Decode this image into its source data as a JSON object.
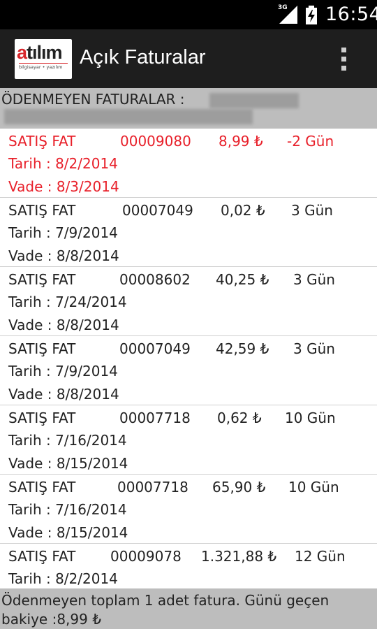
{
  "status_bar": {
    "network": "3G",
    "time": "16:54"
  },
  "app": {
    "logo_text": "atılım",
    "logo_subtext": "bilgisayar • yazılım",
    "title": "Açık Faturalar"
  },
  "header": {
    "label": "ÖDENMEYEN FATURALAR :"
  },
  "invoices": [
    {
      "type": "SATIŞ FAT",
      "number": "00009080",
      "amount": "8,99 ₺",
      "days": "-2 Gün",
      "date": "Tarih : 8/2/2014",
      "due": "Vade : 8/3/2014",
      "overdue": true
    },
    {
      "type": "SATIŞ FAT",
      "number": "00007049",
      "amount": "0,02 ₺",
      "days": "3 Gün",
      "date": "Tarih : 7/9/2014",
      "due": "Vade : 8/8/2014",
      "overdue": false
    },
    {
      "type": "SATIŞ FAT",
      "number": "00008602",
      "amount": "40,25 ₺",
      "days": "3 Gün",
      "date": "Tarih : 7/24/2014",
      "due": "Vade : 8/8/2014",
      "overdue": false
    },
    {
      "type": "SATIŞ FAT",
      "number": "00007049",
      "amount": "42,59 ₺",
      "days": "3 Gün",
      "date": "Tarih : 7/9/2014",
      "due": "Vade : 8/8/2014",
      "overdue": false
    },
    {
      "type": "SATIŞ FAT",
      "number": "00007718",
      "amount": "0,62 ₺",
      "days": "10 Gün",
      "date": "Tarih : 7/16/2014",
      "due": "Vade : 8/15/2014",
      "overdue": false
    },
    {
      "type": "SATIŞ FAT",
      "number": "00007718",
      "amount": "65,90 ₺",
      "days": "10 Gün",
      "date": "Tarih : 7/16/2014",
      "due": "Vade : 8/15/2014",
      "overdue": false
    },
    {
      "type": "SATIŞ FAT",
      "number": "00009078",
      "amount": "1.321,88 ₺",
      "days": "12 Gün",
      "date": "Tarih : 8/2/2014",
      "due": "",
      "overdue": false
    }
  ],
  "footer": {
    "summary": "Ödenmeyen toplam 1 adet fatura. Günü geçen bakiye :8,99 ₺"
  },
  "colors": {
    "overdue": "#e8202a",
    "action_bar": "#1e1e1e",
    "status_bar": "#000000",
    "strip": "#bdbdbd"
  }
}
